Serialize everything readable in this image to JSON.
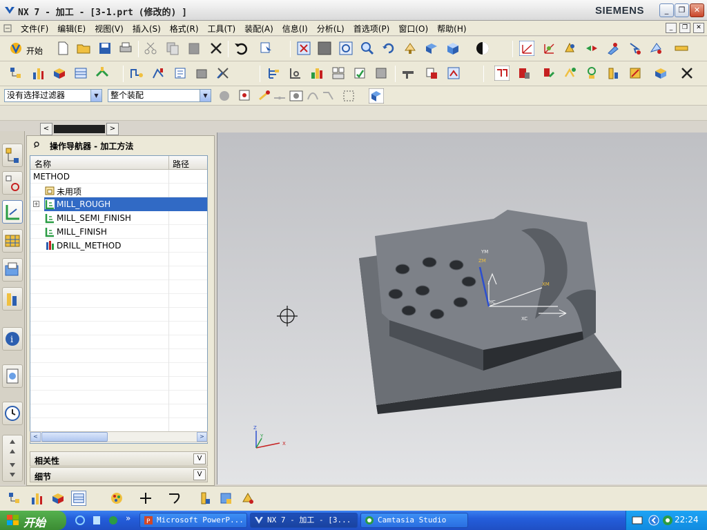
{
  "window": {
    "title": "NX 7 - 加工 - [3-1.prt  (修改的) ]",
    "brand": "SIEMENS",
    "controls": {
      "minimize": "_",
      "restore": "❐",
      "close": "✕"
    }
  },
  "menu": {
    "items": [
      "文件(F)",
      "编辑(E)",
      "视图(V)",
      "插入(S)",
      "格式(R)",
      "工具(T)",
      "装配(A)",
      "信息(I)",
      "分析(L)",
      "首选项(P)",
      "窗口(O)",
      "帮助(H)"
    ],
    "mdi_controls": [
      "_",
      "❐",
      "✕"
    ]
  },
  "toolbar": {
    "start_label": "开始",
    "selection_filter": "没有选择过滤器",
    "assembly_scope": "整个装配",
    "select_arrow": "▼"
  },
  "navigator": {
    "title": "操作导航器 - 加工方法",
    "col_name": "名称",
    "col_path": "路径",
    "rows": [
      {
        "label": "METHOD"
      },
      {
        "label": "未用项"
      },
      {
        "label": "MILL_ROUGH",
        "selected": true,
        "expander": "+"
      },
      {
        "label": "MILL_SEMI_FINISH"
      },
      {
        "label": "MILL_FINISH"
      },
      {
        "label": "DRILL_METHOD"
      }
    ],
    "section_relations": "相关性",
    "section_details": "细节",
    "chevron": "V",
    "scroll_left": "<",
    "scroll_right": ">"
  },
  "splitter": {
    "left": "<",
    "right": ">"
  },
  "viewport": {
    "wcs_labels": {
      "ym": "YM",
      "zm": "ZM",
      "xm": "XM",
      "yc": "YC",
      "xc": "XC"
    },
    "triad_labels": {
      "z": "Z",
      "y": "Y",
      "x": "X"
    }
  },
  "taskbar": {
    "start": "开始",
    "tasks": [
      "Microsoft PowerP...",
      "NX 7 - 加工 - [3...",
      "Camtasia Studio"
    ],
    "clock": "22:24",
    "colors": {
      "bar": "#245edb",
      "start": "#3b8c33"
    }
  }
}
